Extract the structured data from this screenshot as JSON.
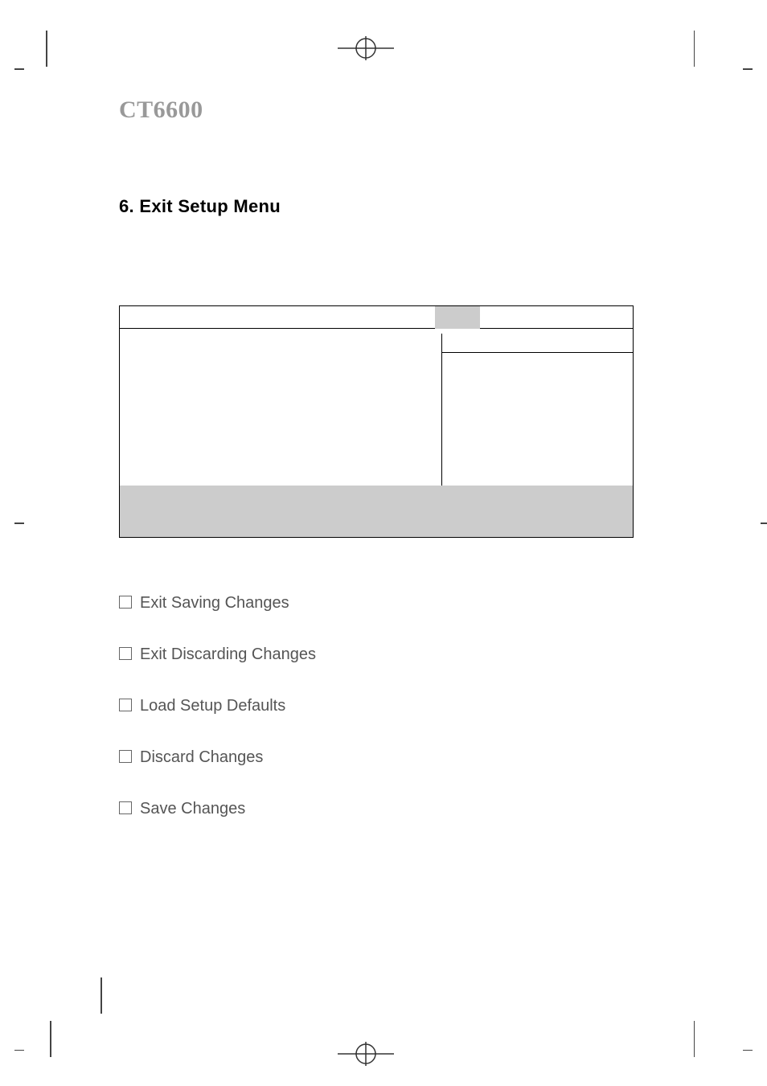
{
  "header": {
    "model": "CT6600"
  },
  "section": {
    "heading": "6. Exit Setup Menu"
  },
  "options": [
    {
      "label": "Exit Saving Changes"
    },
    {
      "label": "Exit Discarding Changes"
    },
    {
      "label": "Load Setup Defaults"
    },
    {
      "label": "Discard Changes"
    },
    {
      "label": "Save Changes"
    }
  ]
}
